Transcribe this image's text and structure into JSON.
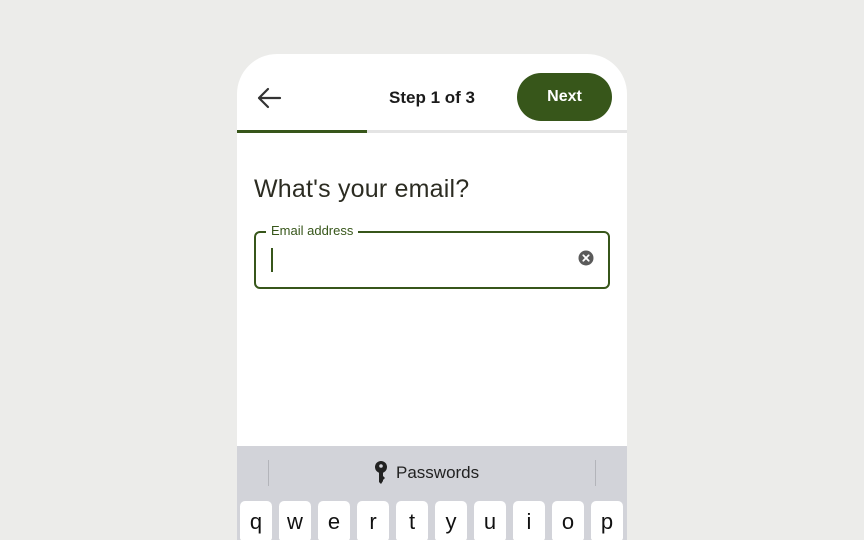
{
  "header": {
    "step_text": "Step 1 of 3",
    "next_label": "Next",
    "progress_fraction": 0.333
  },
  "form": {
    "heading": "What's your email?",
    "email_label": "Email address",
    "email_value": ""
  },
  "keyboard": {
    "suggestion_label": "Passwords",
    "row1": [
      "q",
      "w",
      "e",
      "r",
      "t",
      "y",
      "u",
      "i",
      "o",
      "p"
    ]
  },
  "colors": {
    "accent": "#37561a",
    "keyboard_bg": "#d2d3d9"
  },
  "icons": {
    "back": "arrow-left-icon",
    "clear": "clear-circle-icon",
    "key": "key-icon"
  }
}
